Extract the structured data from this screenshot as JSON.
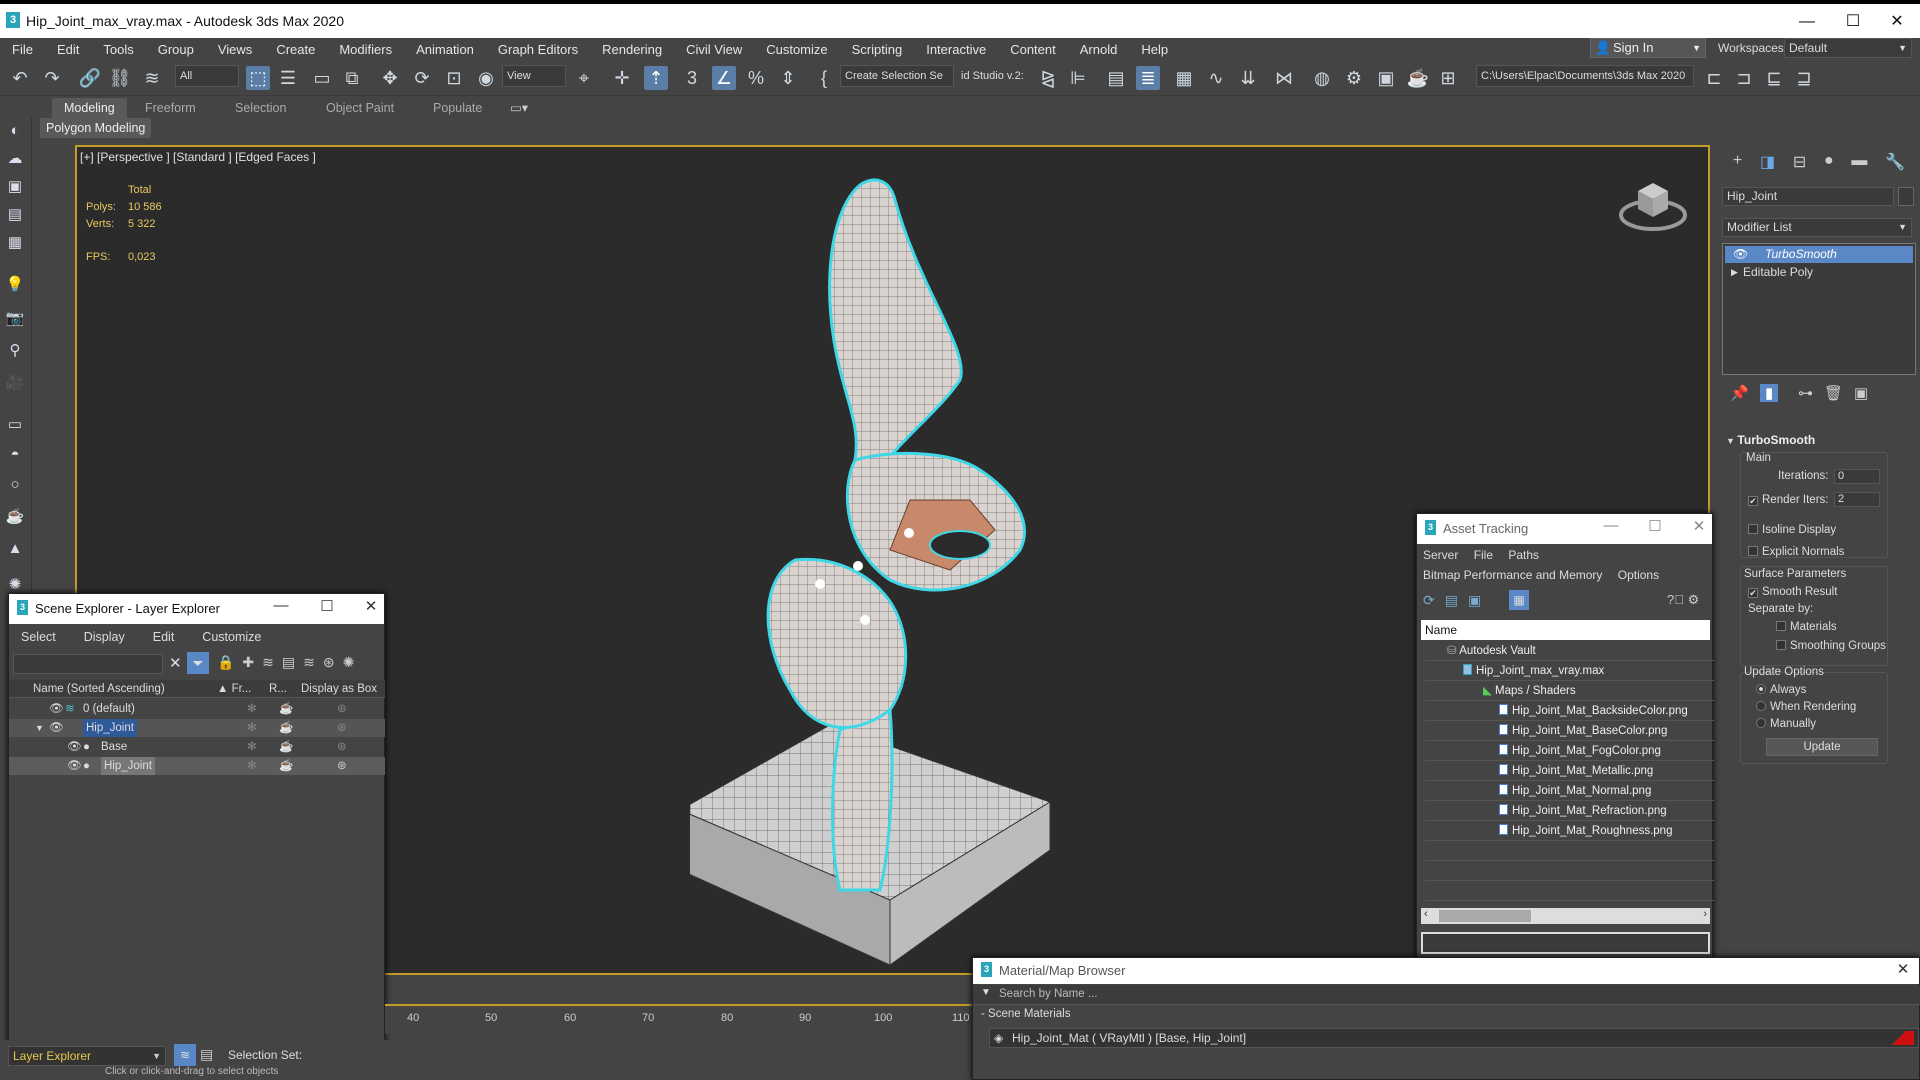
{
  "window": {
    "title": "Hip_Joint_max_vray.max - Autodesk 3ds Max 2020",
    "minimize": "—",
    "maximize": "☐",
    "close": "✕"
  },
  "menu": [
    "File",
    "Edit",
    "Tools",
    "Group",
    "Views",
    "Create",
    "Modifiers",
    "Animation",
    "Graph Editors",
    "Rendering",
    "Civil View",
    "Customize",
    "Scripting",
    "Interactive",
    "Content",
    "Arnold",
    "Help"
  ],
  "signin": {
    "label": "Sign In"
  },
  "workspace": {
    "label": "Workspaces:",
    "value": "Default"
  },
  "toolbar": {
    "filter": "All",
    "refcoord": "View",
    "create_selection": "Create Selection Se",
    "studio": "id Studio v.2:",
    "path": "C:\\Users\\Elpac\\Documents\\3ds Max 2020"
  },
  "ribbon": {
    "tabs": [
      "Modeling",
      "Freeform",
      "Selection",
      "Object Paint",
      "Populate"
    ],
    "active": "Modeling",
    "sub": "Polygon Modeling"
  },
  "viewport": {
    "label": "[+] [Perspective ] [Standard ] [Edged Faces ]",
    "stats": {
      "total_label": "Total",
      "polys_label": "Polys:",
      "polys": "10 586",
      "verts_label": "Verts:",
      "verts": "5 322",
      "fps_label": "FPS:",
      "fps": "0,023"
    }
  },
  "command_panel": {
    "object_name": "Hip_Joint",
    "modifier_list": "Modifier List",
    "stack": [
      "TurboSmooth",
      "Editable Poly"
    ],
    "turbosmooth": {
      "title": "TurboSmooth",
      "main": "Main",
      "iterations_label": "Iterations:",
      "iterations": "0",
      "render_iters_label": "Render Iters:",
      "render_iters": "2",
      "isoline": "Isoline Display",
      "explicit": "Explicit Normals",
      "surface": "Surface Parameters",
      "smooth_result": "Smooth Result",
      "separate_by": "Separate by:",
      "materials": "Materials",
      "smoothing_groups": "Smoothing Groups",
      "update_options": "Update Options",
      "always": "Always",
      "when_rendering": "When Rendering",
      "manually": "Manually",
      "update": "Update"
    }
  },
  "scene_explorer": {
    "title": "Scene Explorer - Layer Explorer",
    "menu": [
      "Select",
      "Display",
      "Edit",
      "Customize"
    ],
    "columns": [
      "Name (Sorted Ascending)",
      "▲ Fr...",
      "R...",
      "Display as Box"
    ],
    "rows": [
      {
        "name": "0 (default)"
      },
      {
        "name": "Hip_Joint"
      },
      {
        "name": "Base"
      },
      {
        "name": "Hip_Joint"
      }
    ]
  },
  "asset_tracking": {
    "title": "Asset Tracking",
    "menu1": [
      "Server",
      "File",
      "Paths"
    ],
    "menu2": [
      "Bitmap Performance and Memory",
      "Options"
    ],
    "column": "Name",
    "rows": [
      "Autodesk Vault",
      "Hip_Joint_max_vray.max",
      "Maps / Shaders",
      "Hip_Joint_Mat_BacksideColor.png",
      "Hip_Joint_Mat_BaseColor.png",
      "Hip_Joint_Mat_FogColor.png",
      "Hip_Joint_Mat_Metallic.png",
      "Hip_Joint_Mat_Normal.png",
      "Hip_Joint_Mat_Refraction.png",
      "Hip_Joint_Mat_Roughness.png"
    ]
  },
  "material_browser": {
    "title": "Material/Map Browser",
    "search": "Search by Name ...",
    "section": "- Scene Materials",
    "item": "Hip_Joint_Mat  ( VRayMtl ) [Base, Hip_Joint]"
  },
  "timeline": {
    "ticks": [
      "40",
      "50",
      "60",
      "70",
      "80",
      "90",
      "100",
      "110"
    ]
  },
  "bottom": {
    "layer": "Layer Explorer",
    "selection_set": "Selection Set:",
    "hint": "Click or click-and-drag to select objects"
  },
  "colors": {
    "accent": "#5a88c6",
    "selection_outline": "#3fd7e6",
    "viewport_border": "#c49a28",
    "stats": "#e8c860"
  }
}
